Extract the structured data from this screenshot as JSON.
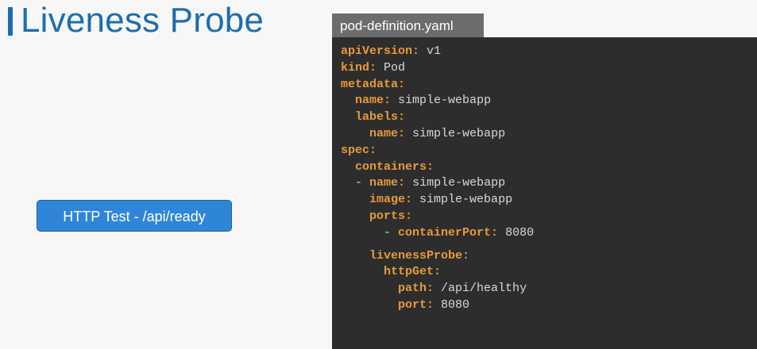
{
  "title": "Liveness Probe",
  "colors": {
    "title": "#1c6eb0",
    "button": "#2f86d8",
    "code_background": "#2d2d2d",
    "tab_background": "#6c6c6c",
    "yaml_key": "#e89a3c",
    "yaml_value": "#d8d8d8"
  },
  "http_test_button": {
    "label": "HTTP Test - /api/ready"
  },
  "editor": {
    "filename": "pod-definition.yaml",
    "lines": [
      {
        "indent": "",
        "dash": "",
        "key": "apiVersion:",
        "value": "v1"
      },
      {
        "indent": "",
        "dash": "",
        "key": "kind:",
        "value": "Pod"
      },
      {
        "indent": "",
        "dash": "",
        "key": "metadata:",
        "value": ""
      },
      {
        "indent": "  ",
        "dash": "",
        "key": "name:",
        "value": "simple-webapp"
      },
      {
        "indent": "  ",
        "dash": "",
        "key": "labels:",
        "value": ""
      },
      {
        "indent": "    ",
        "dash": "",
        "key": "name:",
        "value": "simple-webapp"
      },
      {
        "indent": "",
        "dash": "",
        "key": "spec:",
        "value": ""
      },
      {
        "indent": "  ",
        "dash": "",
        "key": "containers:",
        "value": ""
      },
      {
        "indent": "  ",
        "dash": "- ",
        "key": "name:",
        "value": "simple-webapp"
      },
      {
        "indent": "    ",
        "dash": "",
        "key": "image:",
        "value": "simple-webapp"
      },
      {
        "indent": "    ",
        "dash": "",
        "key": "ports:",
        "value": ""
      },
      {
        "indent": "      ",
        "dash": "- ",
        "key": "containerPort:",
        "value": "8080"
      },
      {
        "indent": "    ",
        "dash": "",
        "key": "livenessProbe:",
        "value": "",
        "gap_before": true
      },
      {
        "indent": "      ",
        "dash": "",
        "key": "httpGet:",
        "value": ""
      },
      {
        "indent": "        ",
        "dash": "",
        "key": "path:",
        "value": "/api/healthy"
      },
      {
        "indent": "        ",
        "dash": "",
        "key": "port:",
        "value": "8080"
      }
    ]
  }
}
